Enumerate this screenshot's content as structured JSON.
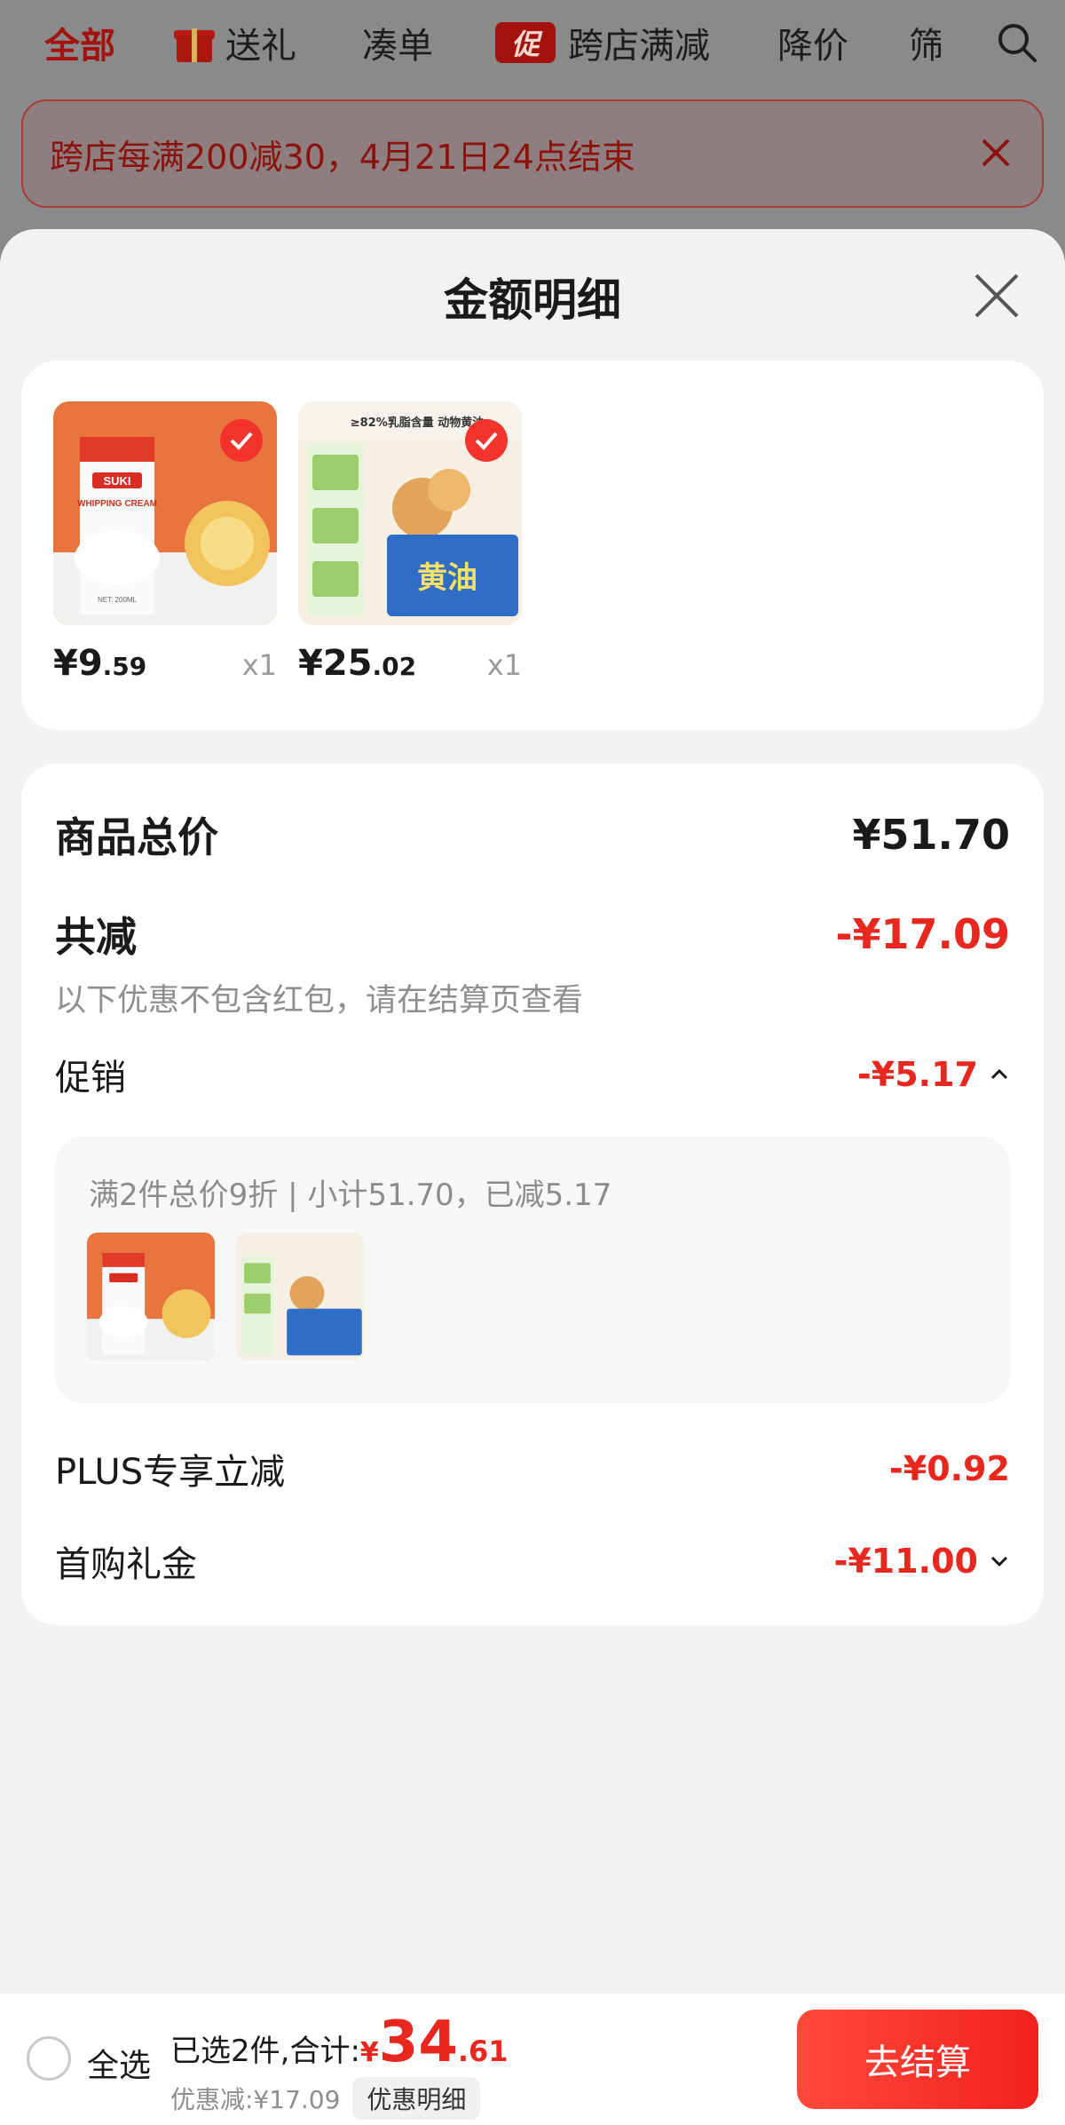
{
  "tabs": [
    "全部",
    "送礼",
    "凑单",
    "跨店满减",
    "降价",
    "筛"
  ],
  "promo_badge": "促",
  "banner": {
    "text": "跨店每满200减30，4月21日24点结束"
  },
  "sheet": {
    "title": "金额明细"
  },
  "products": [
    {
      "price_int": "¥9",
      "price_dec": ".59",
      "qty": "x1",
      "thumb_labels": [
        "SUKI",
        "WHIPPING CREAM",
        "NET: 200ML"
      ]
    },
    {
      "price_int": "¥25",
      "price_dec": ".02",
      "qty": "x1",
      "thumb_labels": [
        "≥82%乳脂含量 动物黄油",
        "黄油"
      ]
    }
  ],
  "summary": {
    "total_label": "商品总价",
    "total_value": "¥51.70",
    "reduce_label": "共减",
    "reduce_value": "-¥17.09",
    "note": "以下优惠不包含红包，请在结算页查看",
    "promo_label": "促销",
    "promo_value": "-¥5.17",
    "promo_detail": "满2件总价9折 | 小计51.70，已减5.17",
    "plus_label": "PLUS专享立减",
    "plus_value": "-¥0.92",
    "gift_label": "首购礼金",
    "gift_value": "-¥11.00"
  },
  "bottom": {
    "select_all": "全选",
    "selected_label": "已选2件,合计:",
    "currency": "¥",
    "total_int": "34",
    "total_dec": ".61",
    "discount": "优惠减:¥17.09",
    "detail_button": "优惠明细",
    "checkout": "去结算"
  },
  "colors": {
    "accent": "#e8271f",
    "active_tab": "#a3120c"
  }
}
